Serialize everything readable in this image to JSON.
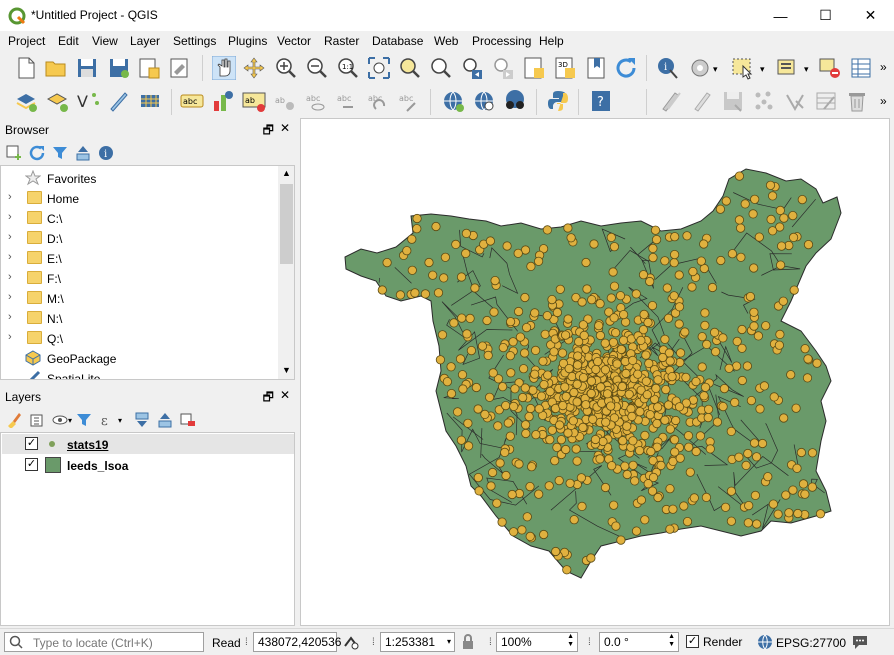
{
  "window": {
    "title": "*Untitled Project - QGIS",
    "min_symbol": "—",
    "max_symbol": "☐",
    "close_symbol": "✕"
  },
  "menu": [
    "Project",
    "Edit",
    "View",
    "Layer",
    "Settings",
    "Plugins",
    "Vector",
    "Raster",
    "Database",
    "Web",
    "Processing",
    "Help"
  ],
  "browser": {
    "title": "Browser",
    "items": [
      {
        "label": "Favorites",
        "icon": "star-icon",
        "expandable": false
      },
      {
        "label": "Home",
        "icon": "folder-icon",
        "expandable": true
      },
      {
        "label": "C:\\",
        "icon": "folder-icon",
        "expandable": true
      },
      {
        "label": "D:\\",
        "icon": "folder-icon",
        "expandable": true
      },
      {
        "label": "E:\\",
        "icon": "folder-icon",
        "expandable": true
      },
      {
        "label": "F:\\",
        "icon": "folder-icon",
        "expandable": true
      },
      {
        "label": "M:\\",
        "icon": "folder-icon",
        "expandable": true
      },
      {
        "label": "N:\\",
        "icon": "folder-icon",
        "expandable": true
      },
      {
        "label": "Q:\\",
        "icon": "folder-icon",
        "expandable": true
      },
      {
        "label": "GeoPackage",
        "icon": "geopackage-icon",
        "expandable": false
      },
      {
        "label": "SpatiaLite",
        "icon": "spatialite-icon",
        "expandable": false
      }
    ]
  },
  "layers": {
    "title": "Layers",
    "items": [
      {
        "name": "stats19",
        "checked": true,
        "symbol": "point",
        "color": "#e0b13f"
      },
      {
        "name": "leeds_lsoa",
        "checked": true,
        "symbol": "polygon",
        "color": "#6a9a6a"
      }
    ]
  },
  "status": {
    "locate_placeholder": "Type to locate (Ctrl+K)",
    "coord_label": "Read",
    "coord_value": "438072,420536",
    "scale_value": "1:253381",
    "magnifier_value": "100%",
    "rotation_value": "0.0 °",
    "render_label": "Render",
    "render_checked": true,
    "crs_label": "EPSG:27700"
  },
  "map": {
    "polygon_fill": "#6a9a6a",
    "polygon_stroke": "#2b2b2b",
    "point_fill": "#e0b13f",
    "point_stroke": "#5a4a14"
  }
}
